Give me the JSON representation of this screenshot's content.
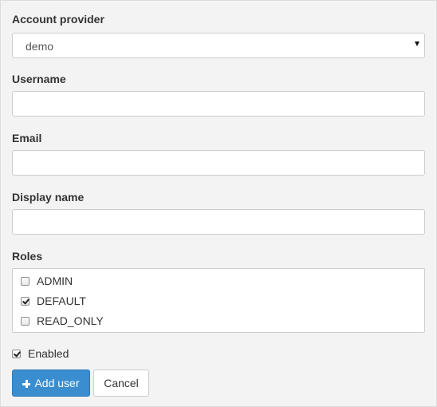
{
  "form": {
    "account_provider": {
      "label": "Account provider",
      "selected": "demo"
    },
    "username": {
      "label": "Username",
      "value": ""
    },
    "email": {
      "label": "Email",
      "value": ""
    },
    "display_name": {
      "label": "Display name",
      "value": ""
    },
    "roles": {
      "label": "Roles",
      "items": [
        {
          "label": "ADMIN",
          "checked": false
        },
        {
          "label": "DEFAULT",
          "checked": true
        },
        {
          "label": "READ_ONLY",
          "checked": false
        }
      ]
    },
    "enabled": {
      "label": "Enabled",
      "checked": true
    },
    "buttons": {
      "add_user_label": "Add user",
      "cancel_label": "Cancel"
    }
  },
  "colors": {
    "primary": "#3a8ed0",
    "background": "#f3f3f3",
    "border": "#cccccc"
  },
  "icons": {
    "add": "plus-icon",
    "select": "caret-down-icon",
    "checkbox_checked": "check-icon"
  }
}
